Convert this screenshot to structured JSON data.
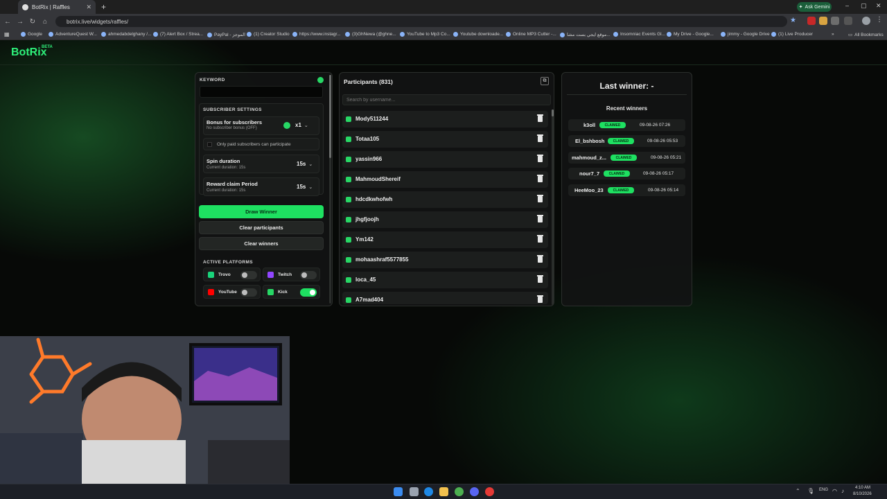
{
  "browser": {
    "tab_title": "BotRix | Raffles",
    "tab_close": "✕",
    "new_tab": "+",
    "url": "botrix.live/widgets/raffles/",
    "ask_gemini": "Ask Gemini",
    "window_controls": {
      "minimize": "–",
      "maximize": "▢",
      "close": "✕"
    },
    "all_bookmarks": "All Bookmarks",
    "bookmarks": [
      "Google",
      "AdventureQuest W...",
      "ahmedabdelghany /...",
      "(7) Alert Box / Strea...",
      "PayPal - الموجز",
      "(1) Creator Studio",
      "https://www.instagr...",
      "(3)GhNewa (@ghne...",
      "YouTube to Mp3 Co...",
      "Youtube downloade...",
      "Online MP3 Cutter -...",
      "موقع ايجي بست مشا...",
      "Insomniac Events Gl...",
      "My Drive - Google...",
      "jimmy - Google Drive",
      "(1) Live Producer"
    ]
  },
  "app": {
    "logo": "BotRix",
    "logo_badge": "BETA"
  },
  "settings": {
    "keyword_label": "KEYWORD",
    "keyword_value": "",
    "subscriber_settings_label": "SUBSCRIBER SETTINGS",
    "bonus_title": "Bonus for subscribers",
    "bonus_sub": "No subscriber bonus (OFF)",
    "bonus_value": "x1",
    "paid_only_label": "Only paid subscribers can participate",
    "spin_title": "Spin duration",
    "spin_sub": "Current duration: 15s",
    "spin_value": "15s",
    "reward_title": "Reward claim Period",
    "reward_sub": "Current duration: 15s",
    "reward_value": "15s",
    "draw_winner": "Draw Winner",
    "clear_participants": "Clear participants",
    "clear_winners": "Clear winners",
    "active_platforms_label": "ACTIVE PLATFORMS",
    "platforms": [
      {
        "name": "Trovo",
        "enabled": false,
        "color": "#19d37a"
      },
      {
        "name": "Twitch",
        "enabled": false,
        "color": "#9146ff"
      },
      {
        "name": "YouTube",
        "enabled": false,
        "color": "#ff0000"
      },
      {
        "name": "Kick",
        "enabled": true,
        "color": "#27d765"
      }
    ]
  },
  "participants": {
    "title": "Participants (831)",
    "search_placeholder": "Search by username...",
    "list": [
      "Mody511244",
      "Totaa105",
      "yassin966",
      "MahmoudShereif",
      "hdcdkwhofwh",
      "jhgfjoojh",
      "Ym142",
      "mohaashraf5577855",
      "loca_45",
      "A7mad404"
    ]
  },
  "winners": {
    "last_winner": "Last winner: -",
    "recent_label": "Recent winners",
    "claimed_label": "CLAIMED",
    "list": [
      {
        "name": "k3oll",
        "time": "09-08-26 07:26"
      },
      {
        "name": "El_bshbosh",
        "time": "09-08-26 05:53"
      },
      {
        "name": "mahmoud_z...",
        "time": "09-08-26 05:21"
      },
      {
        "name": "nour7_7",
        "time": "09-08-26 05:17"
      },
      {
        "name": "HeeMoo_23",
        "time": "09-08-26 05:14"
      }
    ]
  },
  "taskbar": {
    "lang": "ENG",
    "time": "4:10 AM",
    "date": "8/10/2026"
  },
  "colors": {
    "accent": "#1ee061",
    "panel": "#121413",
    "background": "#070907"
  }
}
